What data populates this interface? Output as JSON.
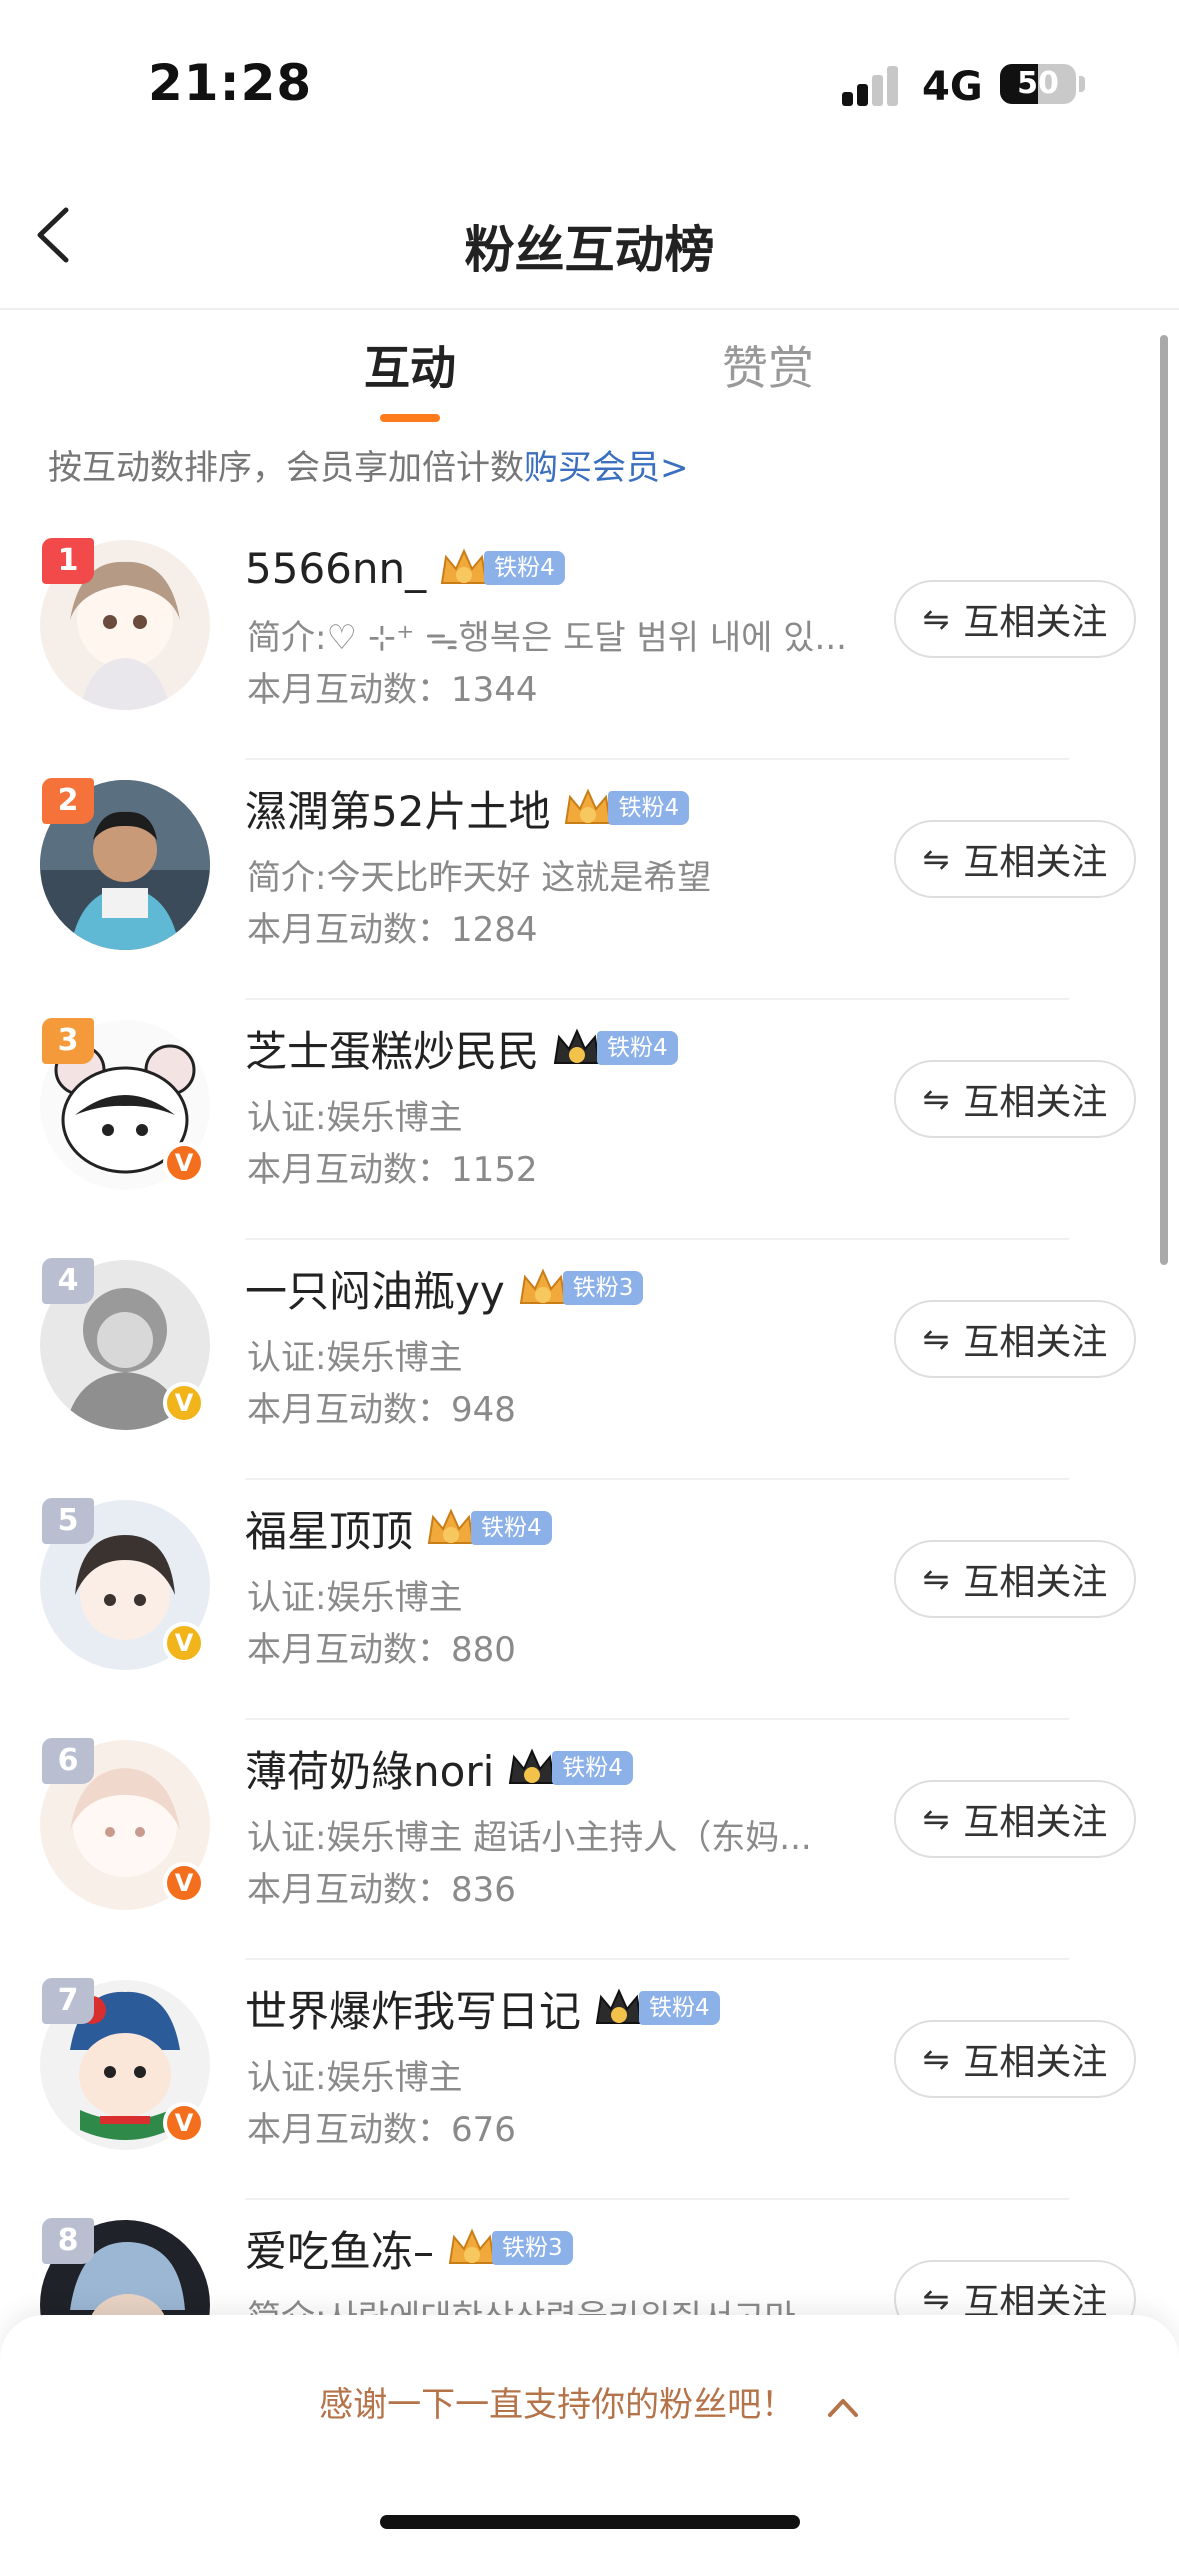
{
  "status_bar": {
    "time": "21:28",
    "network": "4G",
    "battery": "50",
    "battery_level": 0.5
  },
  "nav": {
    "title": "粉丝互动榜"
  },
  "tabs": [
    {
      "label": "互动",
      "active": true
    },
    {
      "label": "赞赏",
      "active": false
    }
  ],
  "hint": {
    "text": "按互动数排序，会员享加倍计数",
    "link": "购买会员>"
  },
  "follow_icon": "⇋",
  "fans": [
    {
      "rank": "1",
      "name": "5566nn_",
      "fan_level": "铁粉4",
      "desc": "简介:♡ ⊹⁺ ᯓ행복은 도달 범위 내에 있...",
      "count": "本月互动数：1344",
      "follow": "互相关注",
      "verified": ""
    },
    {
      "rank": "2",
      "name": "濕潤第52片土地",
      "fan_level": "铁粉4",
      "desc": "简介:今天比昨天好 这就是希望",
      "count": "本月互动数：1284",
      "follow": "互相关注",
      "verified": ""
    },
    {
      "rank": "3",
      "name": "芝士蛋糕炒民民",
      "fan_level": "铁粉4",
      "desc": "认证:娱乐博主",
      "count": "本月互动数：1152",
      "follow": "互相关注",
      "verified": "V"
    },
    {
      "rank": "4",
      "name": "一只闷油瓶yy",
      "fan_level": "铁粉3",
      "desc": "认证:娱乐博主",
      "count": "本月互动数：948",
      "follow": "互相关注",
      "verified": "V"
    },
    {
      "rank": "5",
      "name": "福星顶顶",
      "fan_level": "铁粉4",
      "desc": "认证:娱乐博主",
      "count": "本月互动数：880",
      "follow": "互相关注",
      "verified": "V"
    },
    {
      "rank": "6",
      "name": "薄荷奶綠nori",
      "fan_level": "铁粉4",
      "desc": "认证:娱乐博主 超话小主持人（东妈...",
      "count": "本月互动数：836",
      "follow": "互相关注",
      "verified": "V"
    },
    {
      "rank": "7",
      "name": "世界爆炸我写日记",
      "fan_level": "铁粉4",
      "desc": "认证:娱乐博主",
      "count": "本月互动数：676",
      "follow": "互相关注",
      "verified": "V"
    },
    {
      "rank": "8",
      "name": "爱吃鱼冻–",
      "fan_level": "铁粉3",
      "desc": "简介:사랑에대한상상력을키워줘서고마",
      "count": "",
      "follow": "互相关注",
      "verified": ""
    }
  ],
  "bottom": {
    "thanks": "感谢一下一直支持你的粉丝吧！"
  },
  "colors": {
    "accent": "#ff7a1a",
    "link": "#3b6fbf",
    "rank1": "#f24a4a",
    "rank2": "#f5733a",
    "rank3": "#f59a3a",
    "rank_other": "#b9bfd1",
    "fan_tag": "#8cb0e8"
  }
}
